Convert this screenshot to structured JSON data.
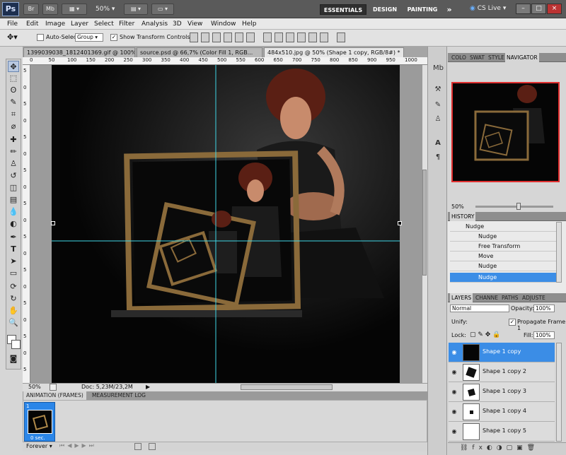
{
  "app": {
    "logo": "Ps",
    "bridge_label": "Br",
    "minibridge_label": "Mb",
    "zoom": "50%",
    "workspaces": [
      "ESSENTIALS",
      "DESIGN",
      "PAINTING"
    ],
    "more": "»",
    "cslive": "CS Live",
    "window_buttons": [
      "–",
      "□",
      "×"
    ]
  },
  "menus": [
    "File",
    "Edit",
    "Image",
    "Layer",
    "Select",
    "Filter",
    "Analysis",
    "3D",
    "View",
    "Window",
    "Help"
  ],
  "options": {
    "auto_select": "Auto-Select:",
    "auto_select_value": "Group",
    "show_transform": "Show Transform Controls",
    "show_transform_checked": "✓"
  },
  "doc_tabs": [
    "1399039038_1812401369.gif @ 100% ...",
    "source.psd @ 66,7% (Color Fill 1, RGB...",
    "484x510.jpg @ 50% (Shape 1 copy, RGB/8#) *"
  ],
  "ruler_top": [
    "0",
    "50",
    "100",
    "150",
    "200",
    "250",
    "300",
    "350",
    "400",
    "450",
    "500",
    "550",
    "600",
    "650",
    "700",
    "750",
    "800",
    "850",
    "900",
    "950",
    "1000"
  ],
  "ruler_left": [
    "5",
    "0",
    "5",
    "0",
    "5",
    "0",
    "5",
    "0",
    "5",
    "0",
    "5",
    "0",
    "5",
    "0",
    "5",
    "0",
    "5",
    "0",
    "5"
  ],
  "status": {
    "zoom": "50%",
    "doc": "Doc: 5,23M/23,2M"
  },
  "animation": {
    "tabs": [
      "ANIMATION (FRAMES)",
      "MEASUREMENT LOG"
    ],
    "frame_number": "1",
    "frame_delay": "0 sec.",
    "loop": "Forever"
  },
  "navigator": {
    "tabs": [
      "COLO",
      "SWAT",
      "STYLE",
      "NAVIGATOR"
    ],
    "zoom": "50%"
  },
  "history": {
    "title": "HISTORY",
    "items": [
      "Nudge",
      "Nudge",
      "Free Transform",
      "Move",
      "Nudge",
      "Nudge"
    ]
  },
  "layers": {
    "tabs": [
      "LAYERS",
      "CHANNE",
      "PATHS",
      "ADJUSTE"
    ],
    "blend_mode": "Normal",
    "opacity_label": "Opacity:",
    "opacity_value": "100%",
    "unify_label": "Unify:",
    "propagate": "Propagate Frame 1",
    "lock_label": "Lock:",
    "fill_label": "Fill:",
    "fill_value": "100%",
    "items": [
      "Shape 1 copy",
      "Shape 1 copy 2",
      "Shape 1 copy 3",
      "Shape 1 copy 4",
      "Shape 1 copy 5"
    ]
  },
  "colors": {
    "accent": "#3b8de6",
    "nav_frame": "#e03030",
    "guide": "#3fd6e6",
    "gold": "#b08a4a"
  }
}
